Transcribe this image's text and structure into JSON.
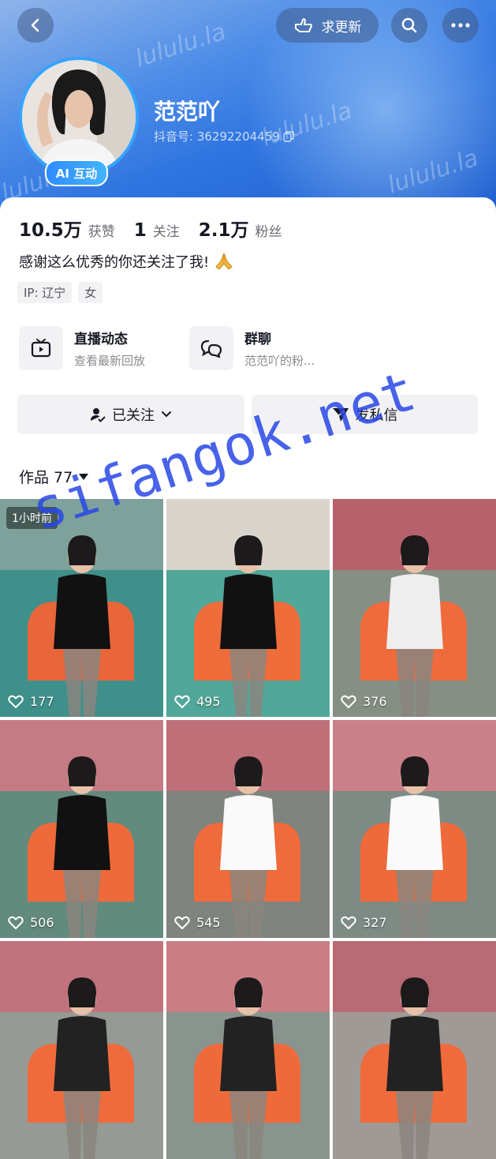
{
  "header": {
    "update_label": "求更新",
    "watermark": "lululu.la"
  },
  "profile": {
    "nickname": "范范吖",
    "douyin_id": "抖音号: 36292204459",
    "ai_badge": "AI 互动"
  },
  "stats": [
    {
      "value": "10.5万",
      "label": "获赞"
    },
    {
      "value": "1",
      "label": "关注"
    },
    {
      "value": "2.1万",
      "label": "粉丝"
    }
  ],
  "bio": "感谢这么优秀的你还关注了我!",
  "tags": [
    "IP: 辽宁",
    "女"
  ],
  "features": [
    {
      "title": "直播动态",
      "subtitle": "查看最新回放",
      "icon": "tv-icon"
    },
    {
      "title": "群聊",
      "subtitle": "范范吖的粉...",
      "icon": "chat-bubbles-icon"
    }
  ],
  "actions": {
    "follow_label": "已关注",
    "message_label": "发私信"
  },
  "works": {
    "label": "作品 77"
  },
  "videos": [
    {
      "likes": "177",
      "badge": "1小时前"
    },
    {
      "likes": "495"
    },
    {
      "likes": "376"
    },
    {
      "likes": "506"
    },
    {
      "likes": "545"
    },
    {
      "likes": "327"
    },
    {
      "likes": ""
    },
    {
      "likes": ""
    },
    {
      "likes": ""
    }
  ],
  "overlay_watermark": "sifangok.net",
  "colors": {
    "header": "#2f74e0",
    "accent": "#35a4ff",
    "badge": "#2f8cff"
  }
}
